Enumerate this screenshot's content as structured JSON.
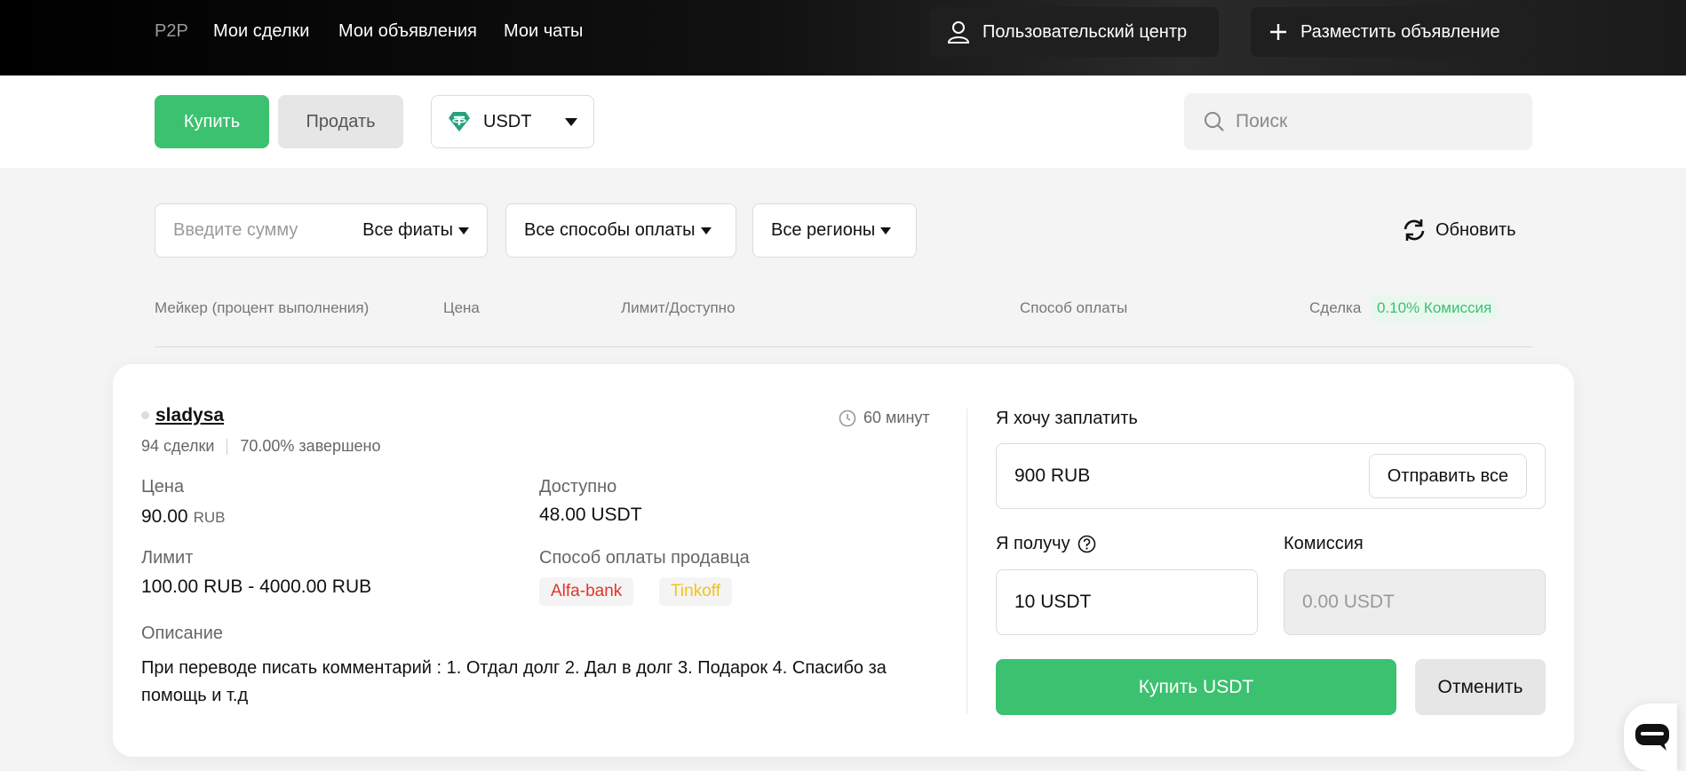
{
  "nav": {
    "p2p": "P2P",
    "my_deals": "Мои сделки",
    "my_ads": "Мои объявления",
    "my_chats": "Мои чаты",
    "user_center": "Пользовательский центр",
    "post_ad": "Разместить объявление"
  },
  "subbar": {
    "buy": "Купить",
    "sell": "Продать",
    "coin": "USDT",
    "search_placeholder": "Поиск"
  },
  "filters": {
    "amount_placeholder": "Введите сумму",
    "fiat": "Все фиаты",
    "payment": "Все способы оплаты",
    "region": "Все регионы",
    "refresh": "Обновить"
  },
  "columns": {
    "maker": "Мейкер (процент выполнения)",
    "price": "Цена",
    "limit": "Лимит/Доступно",
    "method": "Способ оплаты",
    "deal": "Сделка",
    "fee_badge": "0.10% Комиссия"
  },
  "offer": {
    "maker": "sladysa",
    "deals": "94 сделки",
    "completion": "70.00% завершено",
    "time": "60 минут",
    "price_label": "Цена",
    "price_value": "90.00",
    "price_unit": "RUB",
    "available_label": "Доступно",
    "available_value": "48.00 USDT",
    "limit_label": "Лимит",
    "limit_value": "100.00 RUB - 4000.00 RUB",
    "method_label": "Способ оплаты продавца",
    "methods": [
      {
        "name": "Alfa-bank",
        "color": "#e2352d"
      },
      {
        "name": "Tinkoff",
        "color": "#f0c419"
      }
    ],
    "desc_label": "Описание",
    "desc": "При переводе писать комментарий : 1. Отдал долг 2. Дал в долг 3. Подарок 4. Спасибо за помощь и т.д"
  },
  "form": {
    "pay_label": "Я хочу заплатить",
    "pay_value": "900 RUB",
    "send_all": "Отправить все",
    "get_label": "Я получу",
    "get_value": "10 USDT",
    "fee_label": "Комиссия",
    "fee_value": "0.00 USDT",
    "buy_button": "Купить USDT",
    "cancel_button": "Отменить"
  },
  "colors": {
    "accent": "#3cc170",
    "tether": "#26a17b"
  }
}
